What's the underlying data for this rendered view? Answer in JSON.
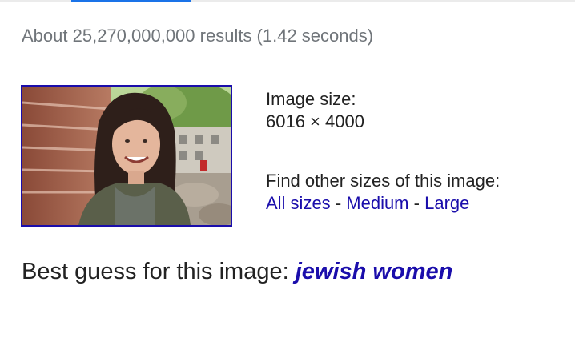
{
  "results": {
    "stats_text": "About 25,270,000,000 results (1.42 seconds)"
  },
  "image_info": {
    "size_label": "Image size:",
    "size_value": "6016 × 4000",
    "other_sizes_label": "Find other sizes of this image:",
    "all_sizes_link": "All sizes",
    "medium_link": "Medium",
    "large_link": "Large",
    "separator": "-"
  },
  "best_guess": {
    "label": "Best guess for this image:",
    "query": "jewish women"
  },
  "colors": {
    "link": "#1a0dab",
    "tab_accent": "#1a73e8",
    "stats_text": "#70757a"
  }
}
